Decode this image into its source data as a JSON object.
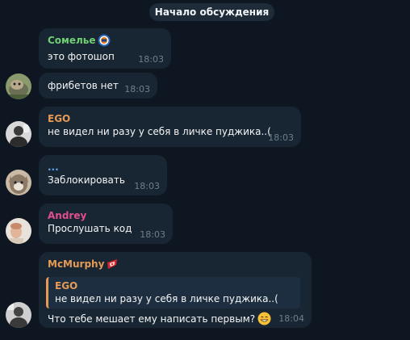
{
  "header": {
    "discussion_label": "Начало обсуждения"
  },
  "colors": {
    "background": "#0e1621",
    "bubble": "#182533",
    "time": "#6d7f8f",
    "name_somelye": "#6fcf72",
    "name_ego": "#e59a55",
    "name_dots": "#5aa9f0",
    "name_andrey": "#e04f8e",
    "name_mcmurphy": "#e59a55"
  },
  "messages": [
    {
      "sender": "Сомелье",
      "text": "это фотошоп",
      "time": "18:03",
      "badge_icon": "hockey-team-logo-icon"
    },
    {
      "sender": "",
      "text": "фрибетов нет",
      "time": "18:03"
    },
    {
      "sender": "EGO",
      "text": "не видел ни разу у себя в личке пуджика..(",
      "time": "18:03"
    },
    {
      "sender": "...",
      "text": "Заблокировать",
      "time": "18:03"
    },
    {
      "sender": "Andrey",
      "text": "Прослушать код",
      "time": "18:03"
    },
    {
      "sender": "McMurphy",
      "badge_icon": "spartak-logo-icon",
      "reply": {
        "sender": "EGO",
        "text": "не видел ни разу у себя в личке пуджика..("
      },
      "text": "Что тебе мешает ему написать первым?",
      "emoji_icon": "grinning-face-emoji-icon",
      "time": "18:04"
    }
  ]
}
